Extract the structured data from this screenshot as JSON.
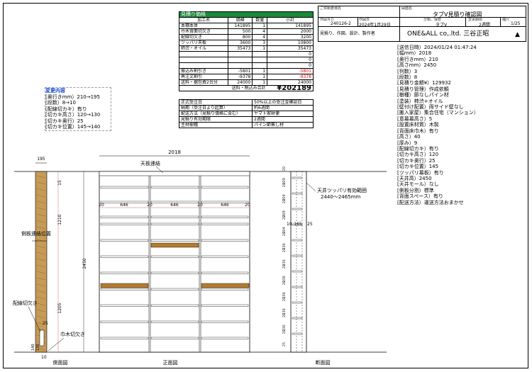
{
  "estimate": {
    "title": "見積り価格",
    "headers": [
      "加工名",
      "価格",
      "数量",
      "小計"
    ],
    "rows": [
      {
        "name": "本棚本体",
        "price": "141895",
        "qty": "1",
        "sub": "141895",
        "red": false
      },
      {
        "name": "巾木背面切欠き",
        "price": "500",
        "qty": "4",
        "sub": "2000",
        "red": false
      },
      {
        "name": "配線切欠き",
        "price": "800",
        "qty": "4",
        "sub": "3200",
        "red": false
      },
      {
        "name": "ツッパリ天板",
        "price": "3600",
        "qty": "3",
        "sub": "10800",
        "red": false
      },
      {
        "name": "柿渋・オイル",
        "price": "35473",
        "qty": "1",
        "sub": "35473",
        "red": false
      },
      {
        "name": "",
        "price": "",
        "qty": "",
        "sub": "0",
        "red": false
      },
      {
        "name": "",
        "price": "",
        "qty": "",
        "sub": "0",
        "red": false
      },
      {
        "name": "",
        "price": "",
        "qty": "",
        "sub": "0",
        "red": false
      },
      {
        "name": "振込み割引き",
        "price": "-5801",
        "qty": "1",
        "sub": "-5801",
        "red": true
      },
      {
        "name": "再注文割引",
        "price": "-9378",
        "qty": "1",
        "sub": "-9378",
        "red": true
      },
      {
        "name": "送料・据包費2台分",
        "price": "24000",
        "qty": "1",
        "sub": "24000",
        "red": false
      }
    ],
    "total_label": "送料・税込み合計",
    "total": "¥202189"
  },
  "conditions": [
    {
      "k": "正式受注日",
      "v": "50%以上の受注金確認日"
    },
    {
      "k": "納期（受注日より起算）",
      "v": "約6週間"
    },
    {
      "k": "配送方法（見積り価格に含む）",
      "v": "ヤマト家財便"
    },
    {
      "k": "見積り有効期限",
      "v": "2週間"
    },
    {
      "k": "主材樹種",
      "v": "パイン節無し材"
    }
  ],
  "header": {
    "customer_label": "ご依頼者様名",
    "customer": "",
    "drawing_label": "図面名",
    "drawing_title": "タブV見積り確認図",
    "work_no_label": "作図ＮＯ",
    "work_no": "240126-2",
    "date_label": "作図日",
    "date": "2024年1月29日",
    "category_label": "分類、保管",
    "category": "タブV",
    "change_label": "変更期限",
    "change": "2週間",
    "scale_label": "縮尺",
    "scale": "1/25",
    "maker_label": "見積り、作図、設計、製作者",
    "maker": "ONE&ALL co,.ltd. 三谷正昭"
  },
  "spec": [
    "送信日時）2024/01/24 01:47:24",
    "幅mm）2018",
    "奥行きmm）210",
    "高さmm）2450",
    "列数）3",
    "段数）8",
    "見積り金額¥）129932",
    "見積り管理）作成依頼",
    "樹種）節なしパイン材",
    "塗装）柿渋+オイル",
    "壁付け配置）両サイド壁なし",
    "搬入家屋）集合住宅（マンション）",
    "意幕幕高さ）5",
    "設置床材質）木製",
    "背面床巾木）有り",
    "高さ）40",
    "厚み）9",
    "配線切カキ）有り",
    "切カキ高さ）120",
    "切カキ奥行）25",
    "切カキ位置）145",
    "ツッパリ幕板）有り",
    "天井高）2450",
    "天井モール）なし",
    "側板分割）標準",
    "背面スペース）有り",
    "配送方法）運送方法おまかせ"
  ],
  "changes": {
    "title": "変更内容",
    "items": [
      "奥行きmm）210→195",
      "段数）8→10",
      "配線切カキ）有り",
      "切カキ高さ）120→130",
      "切カキ奥行）25",
      "切カキ位置）145→140"
    ]
  },
  "drawing": {
    "side_label": "側面図",
    "front_label": "正面図",
    "section_label": "断面図",
    "top_board_label": "天板連結",
    "ceiling_label": "天井ツッパリ有効範囲",
    "ceiling_range": "2440～2465mm",
    "side_connect_label": "側板連結位置",
    "wiring_label": "配線切欠き",
    "baseboard_label": "巾木切欠き",
    "dims": {
      "width": "2018",
      "side_depth": "195",
      "side_top": "15",
      "side_height": "2450",
      "upper": "1210",
      "lower": "1205",
      "col": "646",
      "gap": "20",
      "wire_h1": "25",
      "wire_h2": "140",
      "wire_h3": "130",
      "wire_d": "10",
      "sec_165": "165",
      "sec_25": "25",
      "sec_10": "10",
      "shelf_sp": [
        "20",
        "209",
        "20",
        "204",
        "20",
        "209",
        "20",
        "204",
        "20",
        "236",
        "20",
        "236",
        "20",
        "236",
        "20",
        "236",
        "20",
        "236",
        "20",
        "236",
        "20",
        "25"
      ]
    }
  }
}
